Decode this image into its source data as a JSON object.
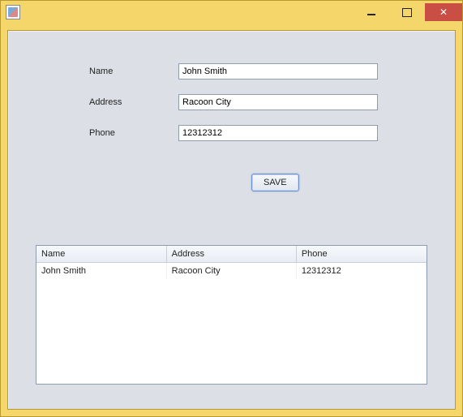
{
  "form": {
    "labels": {
      "name": "Name",
      "address": "Address",
      "phone": "Phone"
    },
    "values": {
      "name": "John Smith",
      "address": "Racoon City",
      "phone": "12312312"
    },
    "save_label": "SAVE"
  },
  "table": {
    "headers": {
      "name": "Name",
      "address": "Address",
      "phone": "Phone"
    },
    "rows": [
      {
        "name": "John Smith",
        "address": "Racoon City",
        "phone": "12312312"
      }
    ]
  }
}
